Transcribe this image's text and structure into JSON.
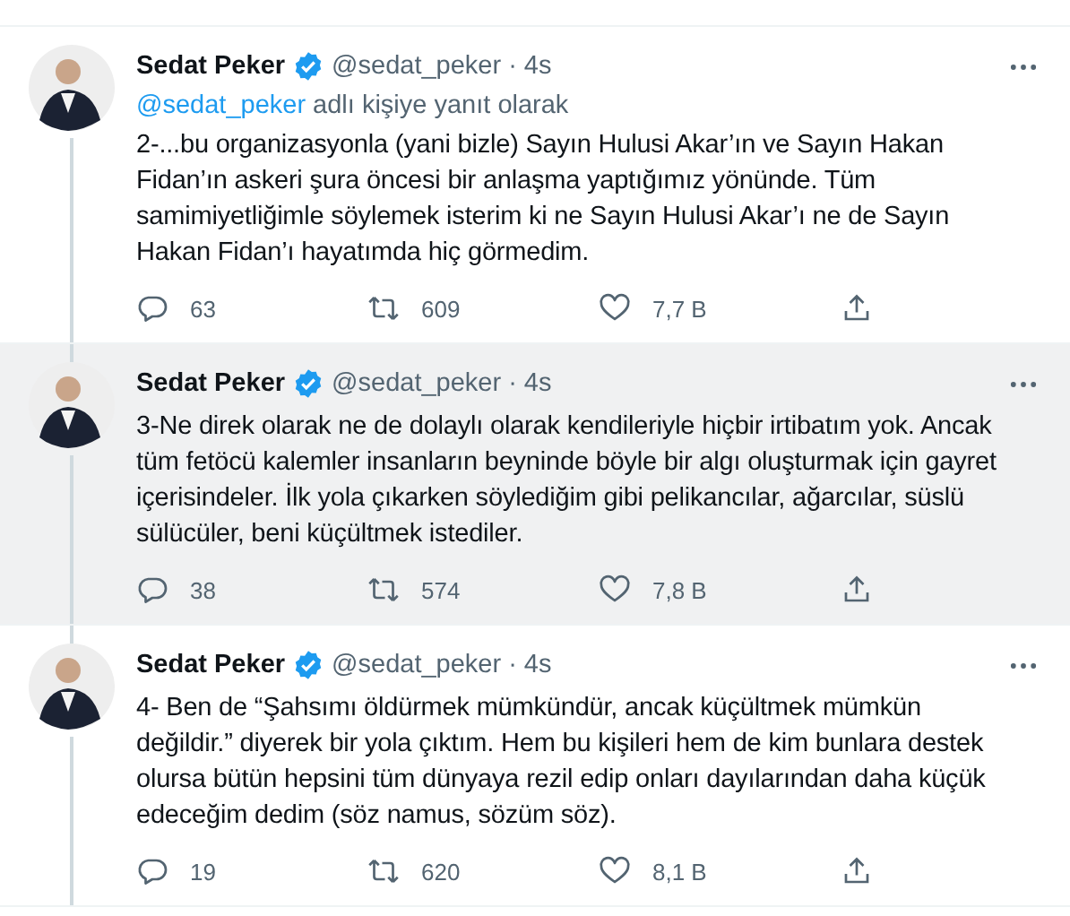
{
  "tweets": [
    {
      "name": "Sedat Peker",
      "verified": true,
      "handle": "@sedat_peker",
      "dot": "·",
      "time": "4s",
      "highlighted": false,
      "reply_to": {
        "handle": "@sedat_peker",
        "text": "adlı kişiye yanıt olarak"
      },
      "text": "2-...bu organizasyonla (yani bizle) Sayın Hulusi Akar’ın ve Sayın Hakan Fidan’ın askeri şura öncesi bir anlaşma yaptığımız yönünde. Tüm samimiyetliğimle söylemek isterim ki ne Sayın Hulusi Akar’ı ne de Sayın Hakan Fidan’ı hayatımda hiç görmedim.",
      "replies": "63",
      "retweets": "609",
      "likes": "7,7 B"
    },
    {
      "name": "Sedat Peker",
      "verified": true,
      "handle": "@sedat_peker",
      "dot": "·",
      "time": "4s",
      "highlighted": true,
      "text": "3-Ne direk olarak ne de dolaylı olarak kendileriyle hiçbir irtibatım yok. Ancak tüm fetöcü kalemler insanların beyninde böyle bir algı oluşturmak için gayret içerisindeler. İlk yola çıkarken söylediğim gibi pelikancılar, ağarcılar, süslü sülücüler, beni küçültmek istediler.",
      "replies": "38",
      "retweets": "574",
      "likes": "7,8 B"
    },
    {
      "name": "Sedat Peker",
      "verified": true,
      "handle": "@sedat_peker",
      "dot": "·",
      "time": "4s",
      "highlighted": false,
      "text": "4- Ben de “Şahsımı öldürmek mümkündür, ancak küçültmek mümkün değildir.” diyerek bir yola çıktım. Hem bu kişileri hem de kim bunlara destek olursa bütün hepsini tüm dünyaya rezil edip onları dayılarından daha küçük edeceğim dedim (söz namus, sözüm söz).",
      "replies": "19",
      "retweets": "620",
      "likes": "8,1 B"
    }
  ]
}
